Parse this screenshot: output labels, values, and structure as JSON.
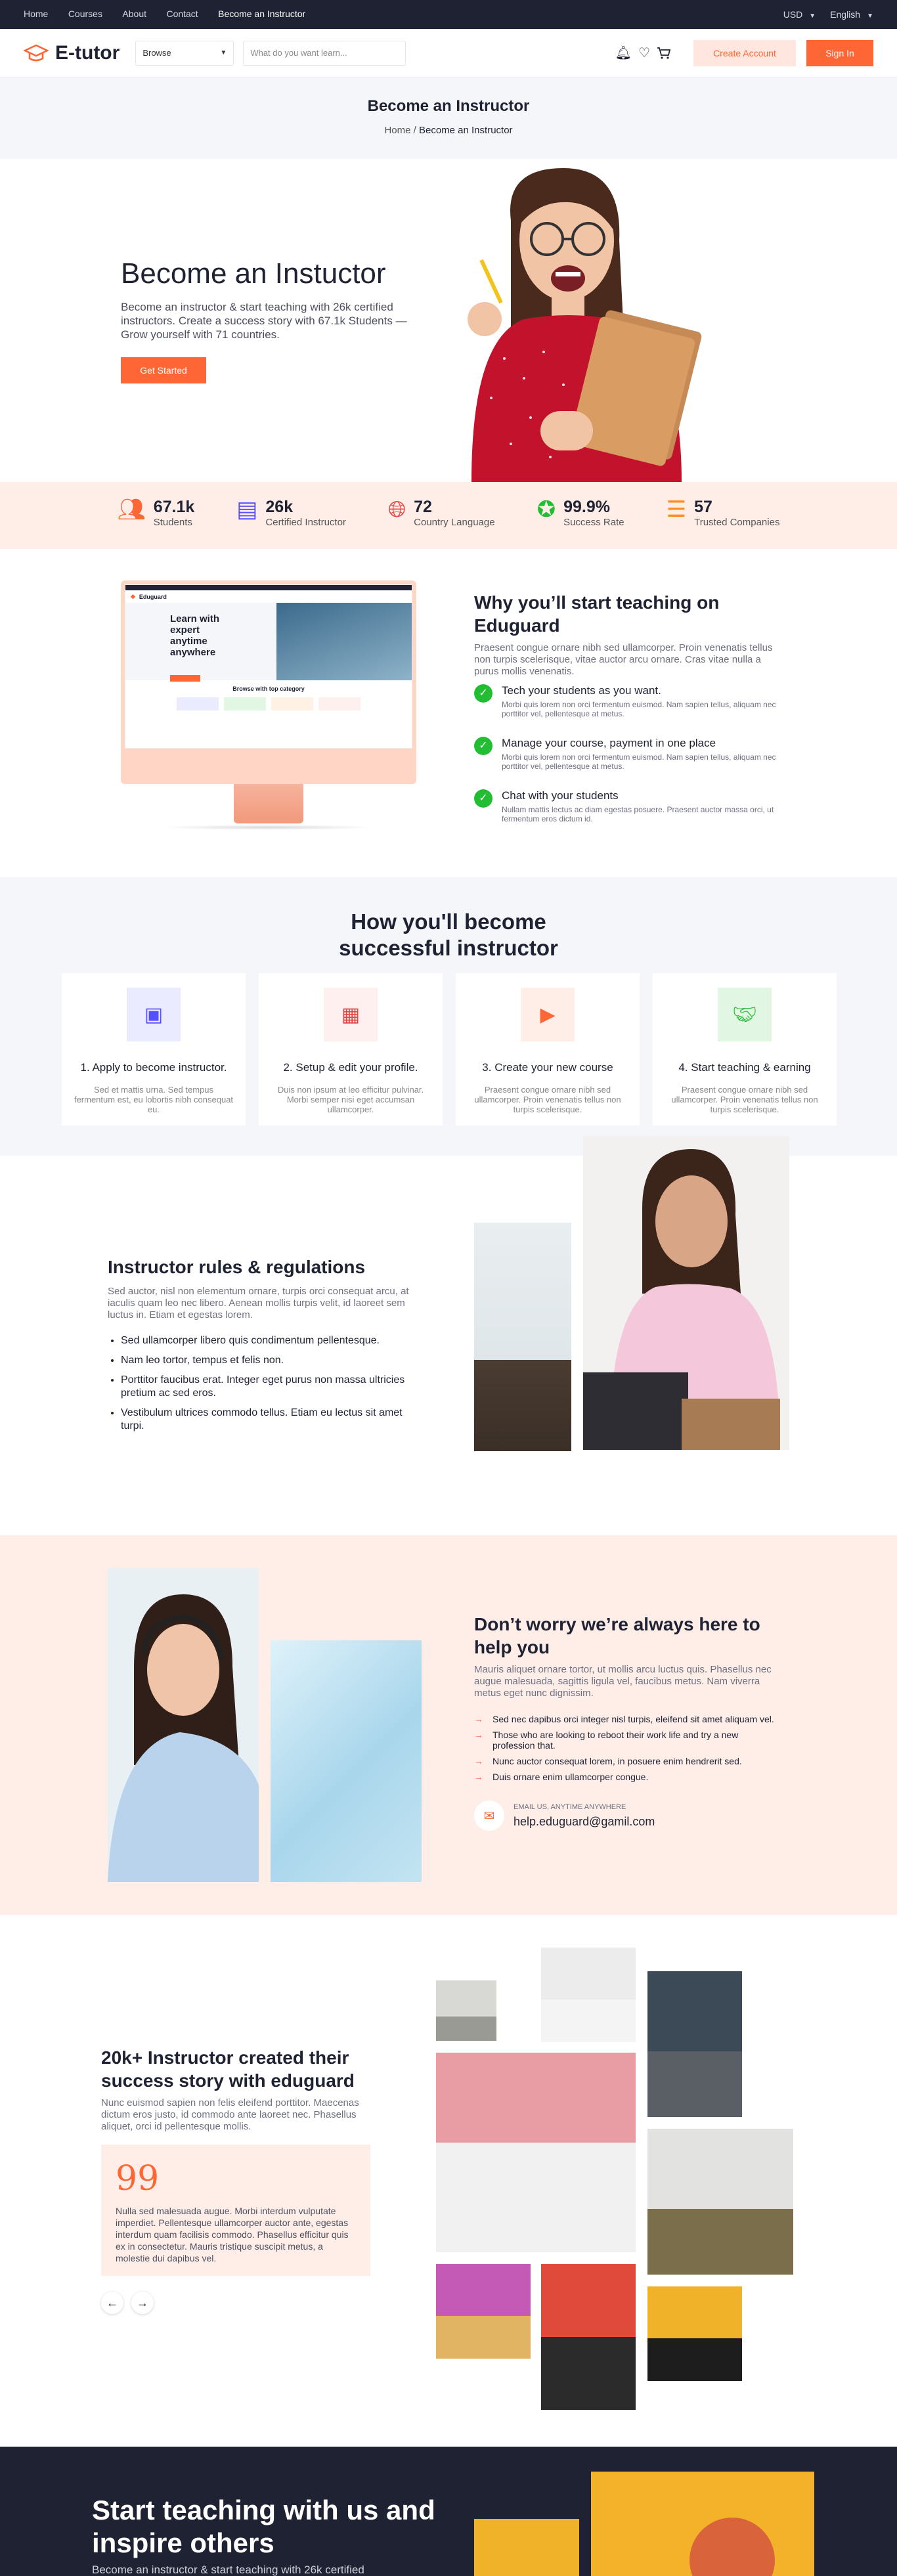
{
  "topbar": {
    "links": [
      "Home",
      "Courses",
      "About",
      "Contact",
      "Become an Instructor"
    ],
    "currency": "USD",
    "language": "English"
  },
  "nav": {
    "brand": "E-tutor",
    "browse": "Browse",
    "search_placeholder": "What do you want learn...",
    "create_account": "Create Account",
    "sign_in": "Sign In"
  },
  "breadcrumb": {
    "title": "Become an Instructor",
    "home": "Home",
    "separator": " / ",
    "current": "Become an Instructor"
  },
  "hero": {
    "title": "Become an Instuctor",
    "text": "Become an instructor & start teaching with 26k certified instructors. Create a success story with 67.1k Students — Grow yourself with 71 countries.",
    "cta": "Get Started"
  },
  "stats": [
    {
      "value": "67.1k",
      "label": "Students",
      "icon": "users-icon",
      "color": "#ff6636"
    },
    {
      "value": "26k",
      "label": "Certified Instructor",
      "icon": "notebook-icon",
      "color": "#564ffd"
    },
    {
      "value": "72",
      "label": "Country Language",
      "icon": "globe-icon",
      "color": "#e34444"
    },
    {
      "value": "99.9%",
      "label": "Success Rate",
      "icon": "seal-check-icon",
      "color": "#23bd33"
    },
    {
      "value": "57",
      "label": "Trusted Companies",
      "icon": "stack-icon",
      "color": "#fd8e1f"
    }
  ],
  "why": {
    "title": "Why you’ll start teaching on Eduguard",
    "lead": "Praesent congue ornare nibh sed ullamcorper. Proin venenatis tellus non turpis scelerisque, vitae auctor arcu ornare. Cras vitae nulla a purus mollis venenatis.",
    "items": [
      {
        "title": "Tech your students as you want.",
        "text": "Morbi quis lorem non orci fermentum euismod. Nam sapien tellus, aliquam nec porttitor vel, pellentesque at metus."
      },
      {
        "title": "Manage your course, payment in one place",
        "text": "Morbi quis lorem non orci fermentum euismod. Nam sapien tellus, aliquam nec porttitor vel, pellentesque at metus."
      },
      {
        "title": "Chat with your students",
        "text": "Nullam mattis lectus ac diam egestas posuere. Praesent auctor massa orci, ut fermentum eros dictum id."
      }
    ],
    "mock": {
      "brand": "Eduguard",
      "headline": "Learn with expert anytime anywhere",
      "sub": "Browse with top category"
    }
  },
  "steps": {
    "title": "How you'll become successful instructor",
    "items": [
      {
        "title": "1. Apply to become instructor.",
        "text": "Sed et mattis urna. Sed tempus fermentum est, eu lobortis nibh consequat eu.",
        "icon": "identification-card-icon",
        "bg": "#ebebff",
        "fg": "#564ffd"
      },
      {
        "title": "2. Setup & edit your profile.",
        "text": "Duis non ipsum at leo efficitur pulvinar. Morbi semper nisi eget accumsan ullamcorper.",
        "icon": "identification-badge-icon",
        "bg": "#fff0f0",
        "fg": "#e34444"
      },
      {
        "title": "3. Create your new course",
        "text": "Praesent congue ornare nibh sed ullamcorper. Proin venenatis tellus non turpis scelerisque.",
        "icon": "play-circle-icon",
        "bg": "#ffeee8",
        "fg": "#ff6636"
      },
      {
        "title": "4. Start teaching & earning",
        "text": "Praesent congue ornare nibh sed ullamcorper. Proin venenatis tellus non turpis scelerisque.",
        "icon": "handshake-icon",
        "bg": "#e1f7e3",
        "fg": "#23bd33"
      }
    ]
  },
  "rules": {
    "title": "Instructor rules & regulations",
    "lead": "Sed auctor, nisl non elementum ornare, turpis orci consequat arcu, at iaculis quam leo nec libero. Aenean mollis turpis velit, id laoreet sem luctus in. Etiam et egestas lorem.",
    "items": [
      "Sed ullamcorper libero quis condimentum pellentesque.",
      "Nam leo tortor, tempus et felis non.",
      "Porttitor faucibus erat. Integer eget purus non massa ultricies pretium ac sed eros.",
      "Vestibulum ultrices commodo tellus. Etiam eu lectus sit amet turpi."
    ]
  },
  "help": {
    "title": "Don’t worry we’re always here to help you",
    "lead": "Mauris aliquet ornare tortor, ut mollis arcu luctus quis. Phasellus nec augue malesuada, sagittis ligula vel, faucibus metus. Nam viverra metus eget nunc dignissim.",
    "items": [
      "Sed nec dapibus orci integer nisl turpis, eleifend sit amet aliquam vel.",
      "Those who are looking to reboot their work life and try a new profession that.",
      "Nunc auctor consequat lorem, in posuere enim hendrerit sed.",
      "Duis ornare enim ullamcorper congue."
    ],
    "email_label": "EMAIL US, ANYTIME ANYWHERE",
    "email": "help.eduguard@gamil.com"
  },
  "success": {
    "title": "20k+ Instructor created their success story with eduguard",
    "lead": "Nunc euismod sapien non felis eleifend porttitor. Maecenas dictum eros justo, id commodo ante laoreet nec. Phasellus aliquet, orci id pellentesque mollis.",
    "quote_mark": "99",
    "quote": "Nulla sed malesuada augue. Morbi interdum vulputate imperdiet. Pellentesque ullamcorper auctor ante, egestas interdum quam facilisis commodo. Phasellus efficitur quis ex in consectetur. Mauris tristique suscipit metus, a molestie dui dapibus vel.",
    "prev": "←",
    "next": "→"
  },
  "footer": {
    "title": "Start teaching with us and inspire others",
    "text": "Become an instructor & start teaching with 26k certified"
  },
  "colors": {
    "accent": "#ff6636",
    "dark": "#1f2233",
    "peach": "#ffeee8"
  }
}
